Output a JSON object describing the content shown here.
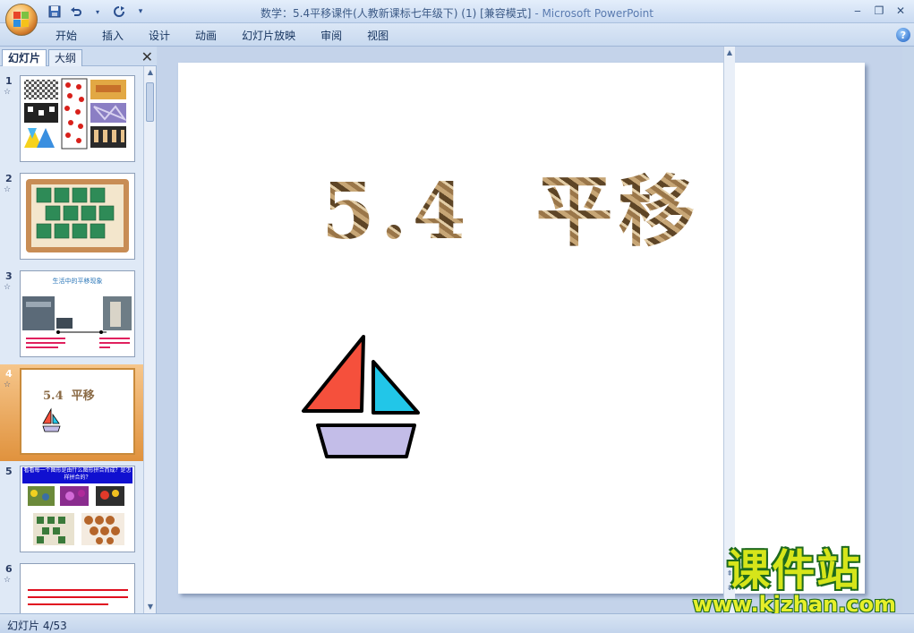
{
  "window": {
    "title": "数学：5.4平移课件(人教新课标七年级下) (1) [兼容模式]",
    "app_name": "- Microsoft PowerPoint",
    "minimize": "‒",
    "restore": "❐",
    "close": "✕"
  },
  "ribbon": {
    "tabs": [
      "开始",
      "插入",
      "设计",
      "动画",
      "幻灯片放映",
      "审阅",
      "视图"
    ]
  },
  "left_pane": {
    "tabs": [
      "幻灯片",
      "大纲"
    ],
    "thumbnails": [
      {
        "number": "1"
      },
      {
        "number": "2"
      },
      {
        "number": "3",
        "caption": "生活中的平移现象"
      },
      {
        "number": "4",
        "caption": "5.4  平移",
        "selected": true
      },
      {
        "number": "5",
        "caption": "看看每一个图形是由什么图形拼合而成？是怎样拼合的？"
      },
      {
        "number": "6"
      }
    ]
  },
  "slide": {
    "title": "5.4  平移"
  },
  "watermark": {
    "brand": "课件站",
    "url": "www.kjzhan.com"
  },
  "status": {
    "slide_indicator": "幻灯片 4/53"
  },
  "colors": {
    "sail_left": "#f5503c",
    "sail_right": "#22c6e8",
    "hull": "#c3bde8"
  }
}
